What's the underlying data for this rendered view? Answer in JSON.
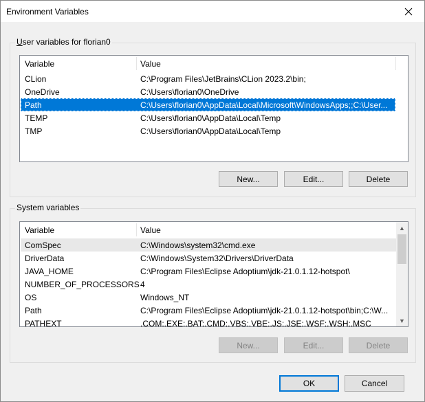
{
  "window": {
    "title": "Environment Variables"
  },
  "user_group": {
    "title": "User variables for florian0",
    "columns": [
      "Variable",
      "Value"
    ],
    "rows": [
      {
        "variable": "CLion",
        "value": "C:\\Program Files\\JetBrains\\CLion 2023.2\\bin;"
      },
      {
        "variable": "OneDrive",
        "value": "C:\\Users\\florian0\\OneDrive"
      },
      {
        "variable": "Path",
        "value": "C:\\Users\\florian0\\AppData\\Local\\Microsoft\\WindowsApps;;C:\\User..."
      },
      {
        "variable": "TEMP",
        "value": "C:\\Users\\florian0\\AppData\\Local\\Temp"
      },
      {
        "variable": "TMP",
        "value": "C:\\Users\\florian0\\AppData\\Local\\Temp"
      }
    ],
    "buttons": {
      "new": "New...",
      "edit": "Edit...",
      "delete": "Delete"
    }
  },
  "system_group": {
    "title": "System variables",
    "columns": [
      "Variable",
      "Value"
    ],
    "rows": [
      {
        "variable": "ComSpec",
        "value": "C:\\Windows\\system32\\cmd.exe"
      },
      {
        "variable": "DriverData",
        "value": "C:\\Windows\\System32\\Drivers\\DriverData"
      },
      {
        "variable": "JAVA_HOME",
        "value": "C:\\Program Files\\Eclipse Adoptium\\jdk-21.0.1.12-hotspot\\"
      },
      {
        "variable": "NUMBER_OF_PROCESSORS",
        "value": "4"
      },
      {
        "variable": "OS",
        "value": "Windows_NT"
      },
      {
        "variable": "Path",
        "value": "C:\\Program Files\\Eclipse Adoptium\\jdk-21.0.1.12-hotspot\\bin;C:\\W..."
      },
      {
        "variable": "PATHEXT",
        "value": ".COM;.EXE;.BAT;.CMD;.VBS;.VBE;.JS;.JSE;.WSF;.WSH;.MSC"
      }
    ],
    "buttons": {
      "new": "New...",
      "edit": "Edit...",
      "delete": "Delete"
    }
  },
  "footer": {
    "ok": "OK",
    "cancel": "Cancel"
  },
  "colors": {
    "selection": "#0078d7",
    "window_bg": "#f0f0f0"
  }
}
